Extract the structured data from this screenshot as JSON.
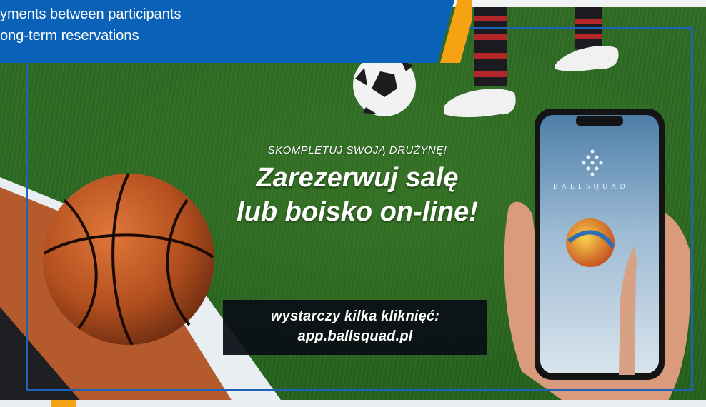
{
  "banner": {
    "line1": "yments between participants",
    "line2": "ong-term reservations",
    "background_color": "#0a62b8",
    "accent_color": "#f5a313"
  },
  "ad": {
    "kicker": "SKOMPLETUJ SWOJĄ DRUŻYNĘ!",
    "headline_line1": "Zarezerwuj salę",
    "headline_line2": "lub boisko on-line!",
    "cta_line1": "wystarczy kilka kliknięć:",
    "cta_line2": "app.ballsquad.pl",
    "brand": "BALLSQUAD",
    "frame_color": "#1e63b8",
    "images": [
      "soccer-ball-icon",
      "basketball-icon",
      "phone-in-hand",
      "volleyball-icon",
      "sneakers"
    ]
  }
}
